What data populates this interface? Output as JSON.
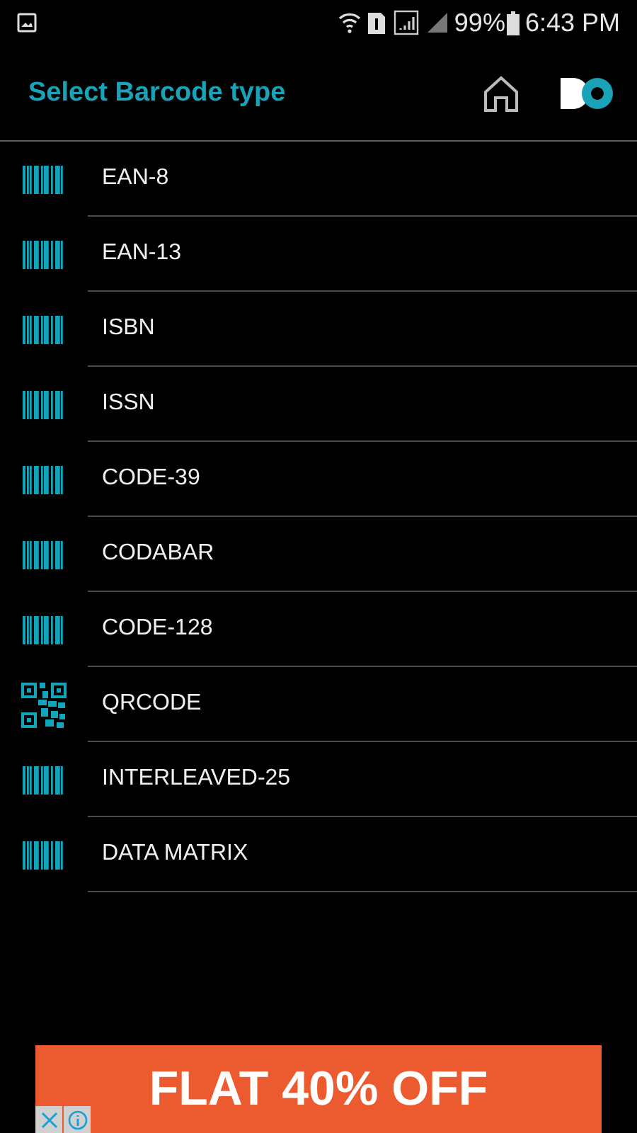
{
  "status_bar": {
    "battery": "99%",
    "time": "6:43 PM"
  },
  "header": {
    "title": "Select Barcode type"
  },
  "items": [
    {
      "label": "EAN-8",
      "kind": "barcode"
    },
    {
      "label": "EAN-13",
      "kind": "barcode"
    },
    {
      "label": "ISBN",
      "kind": "barcode"
    },
    {
      "label": "ISSN",
      "kind": "barcode"
    },
    {
      "label": "CODE-39",
      "kind": "barcode"
    },
    {
      "label": "CODABAR",
      "kind": "barcode"
    },
    {
      "label": "CODE-128",
      "kind": "barcode"
    },
    {
      "label": "QRCODE",
      "kind": "qr"
    },
    {
      "label": "INTERLEAVED-25",
      "kind": "barcode"
    },
    {
      "label": "DATA MATRIX",
      "kind": "barcode"
    }
  ],
  "ad": {
    "headline": "FLAT 40% OFF"
  }
}
